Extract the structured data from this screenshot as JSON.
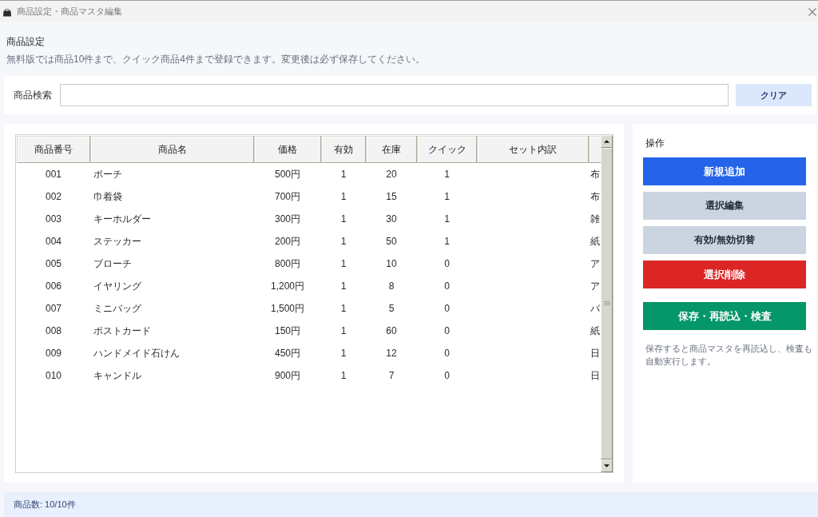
{
  "window": {
    "title": "商品設定・商品マスタ編集"
  },
  "header": {
    "title": "商品設定",
    "description": "無料版では商品10件まで、クイック商品4件まで登録できます。変更後は必ず保存してください。"
  },
  "search": {
    "label": "商品検索",
    "button": "クリア"
  },
  "table": {
    "columns": [
      "商品番号",
      "商品名",
      "価格",
      "有効",
      "在庫",
      "クイック",
      "セット内訳"
    ],
    "rows": [
      {
        "number": "001",
        "name": "ポーチ",
        "price": "500円",
        "active": "1",
        "stock": "20",
        "quick": "1",
        "column_8": "布"
      },
      {
        "number": "002",
        "name": "巾着袋",
        "price": "700円",
        "active": "1",
        "stock": "15",
        "quick": "1",
        "column_8": "布"
      },
      {
        "number": "003",
        "name": "キーホルダー",
        "price": "300円",
        "active": "1",
        "stock": "30",
        "quick": "1",
        "column_8": "雑"
      },
      {
        "number": "004",
        "name": "ステッカー",
        "price": "200円",
        "active": "1",
        "stock": "50",
        "quick": "1",
        "column_8": "紙"
      },
      {
        "number": "005",
        "name": "ブローチ",
        "price": "800円",
        "active": "1",
        "stock": "10",
        "quick": "0",
        "column_8": "ア"
      },
      {
        "number": "006",
        "name": "イヤリング",
        "price": "1,200円",
        "active": "1",
        "stock": "8",
        "quick": "0",
        "column_8": "ア"
      },
      {
        "number": "007",
        "name": "ミニバッグ",
        "price": "1,500円",
        "active": "1",
        "stock": "5",
        "quick": "0",
        "column_8": "バ"
      },
      {
        "number": "008",
        "name": "ポストカード",
        "price": "150円",
        "active": "1",
        "stock": "60",
        "quick": "0",
        "column_8": "紙"
      },
      {
        "number": "009",
        "name": "ハンドメイド石けん",
        "price": "450円",
        "active": "1",
        "stock": "12",
        "quick": "0",
        "column_8": "日"
      },
      {
        "number": "010",
        "name": "キャンドル",
        "price": "900円",
        "active": "1",
        "stock": "7",
        "quick": "0",
        "column_8": "日"
      }
    ]
  },
  "actions": {
    "title": "操作",
    "buttons": [
      {
        "label": "新規追加",
        "kind": "primary"
      },
      {
        "label": "選択編集",
        "kind": "secondary"
      },
      {
        "label": "有効/無効切替",
        "kind": "secondary"
      },
      {
        "label": "選択削除",
        "kind": "danger"
      },
      {
        "label": "保存・再読込・検査",
        "kind": "success"
      }
    ],
    "note": "保存すると商品マスタを再読込し、検査も自動実行します。"
  },
  "status_bar": {
    "text": "商品数: 10/10件"
  }
}
